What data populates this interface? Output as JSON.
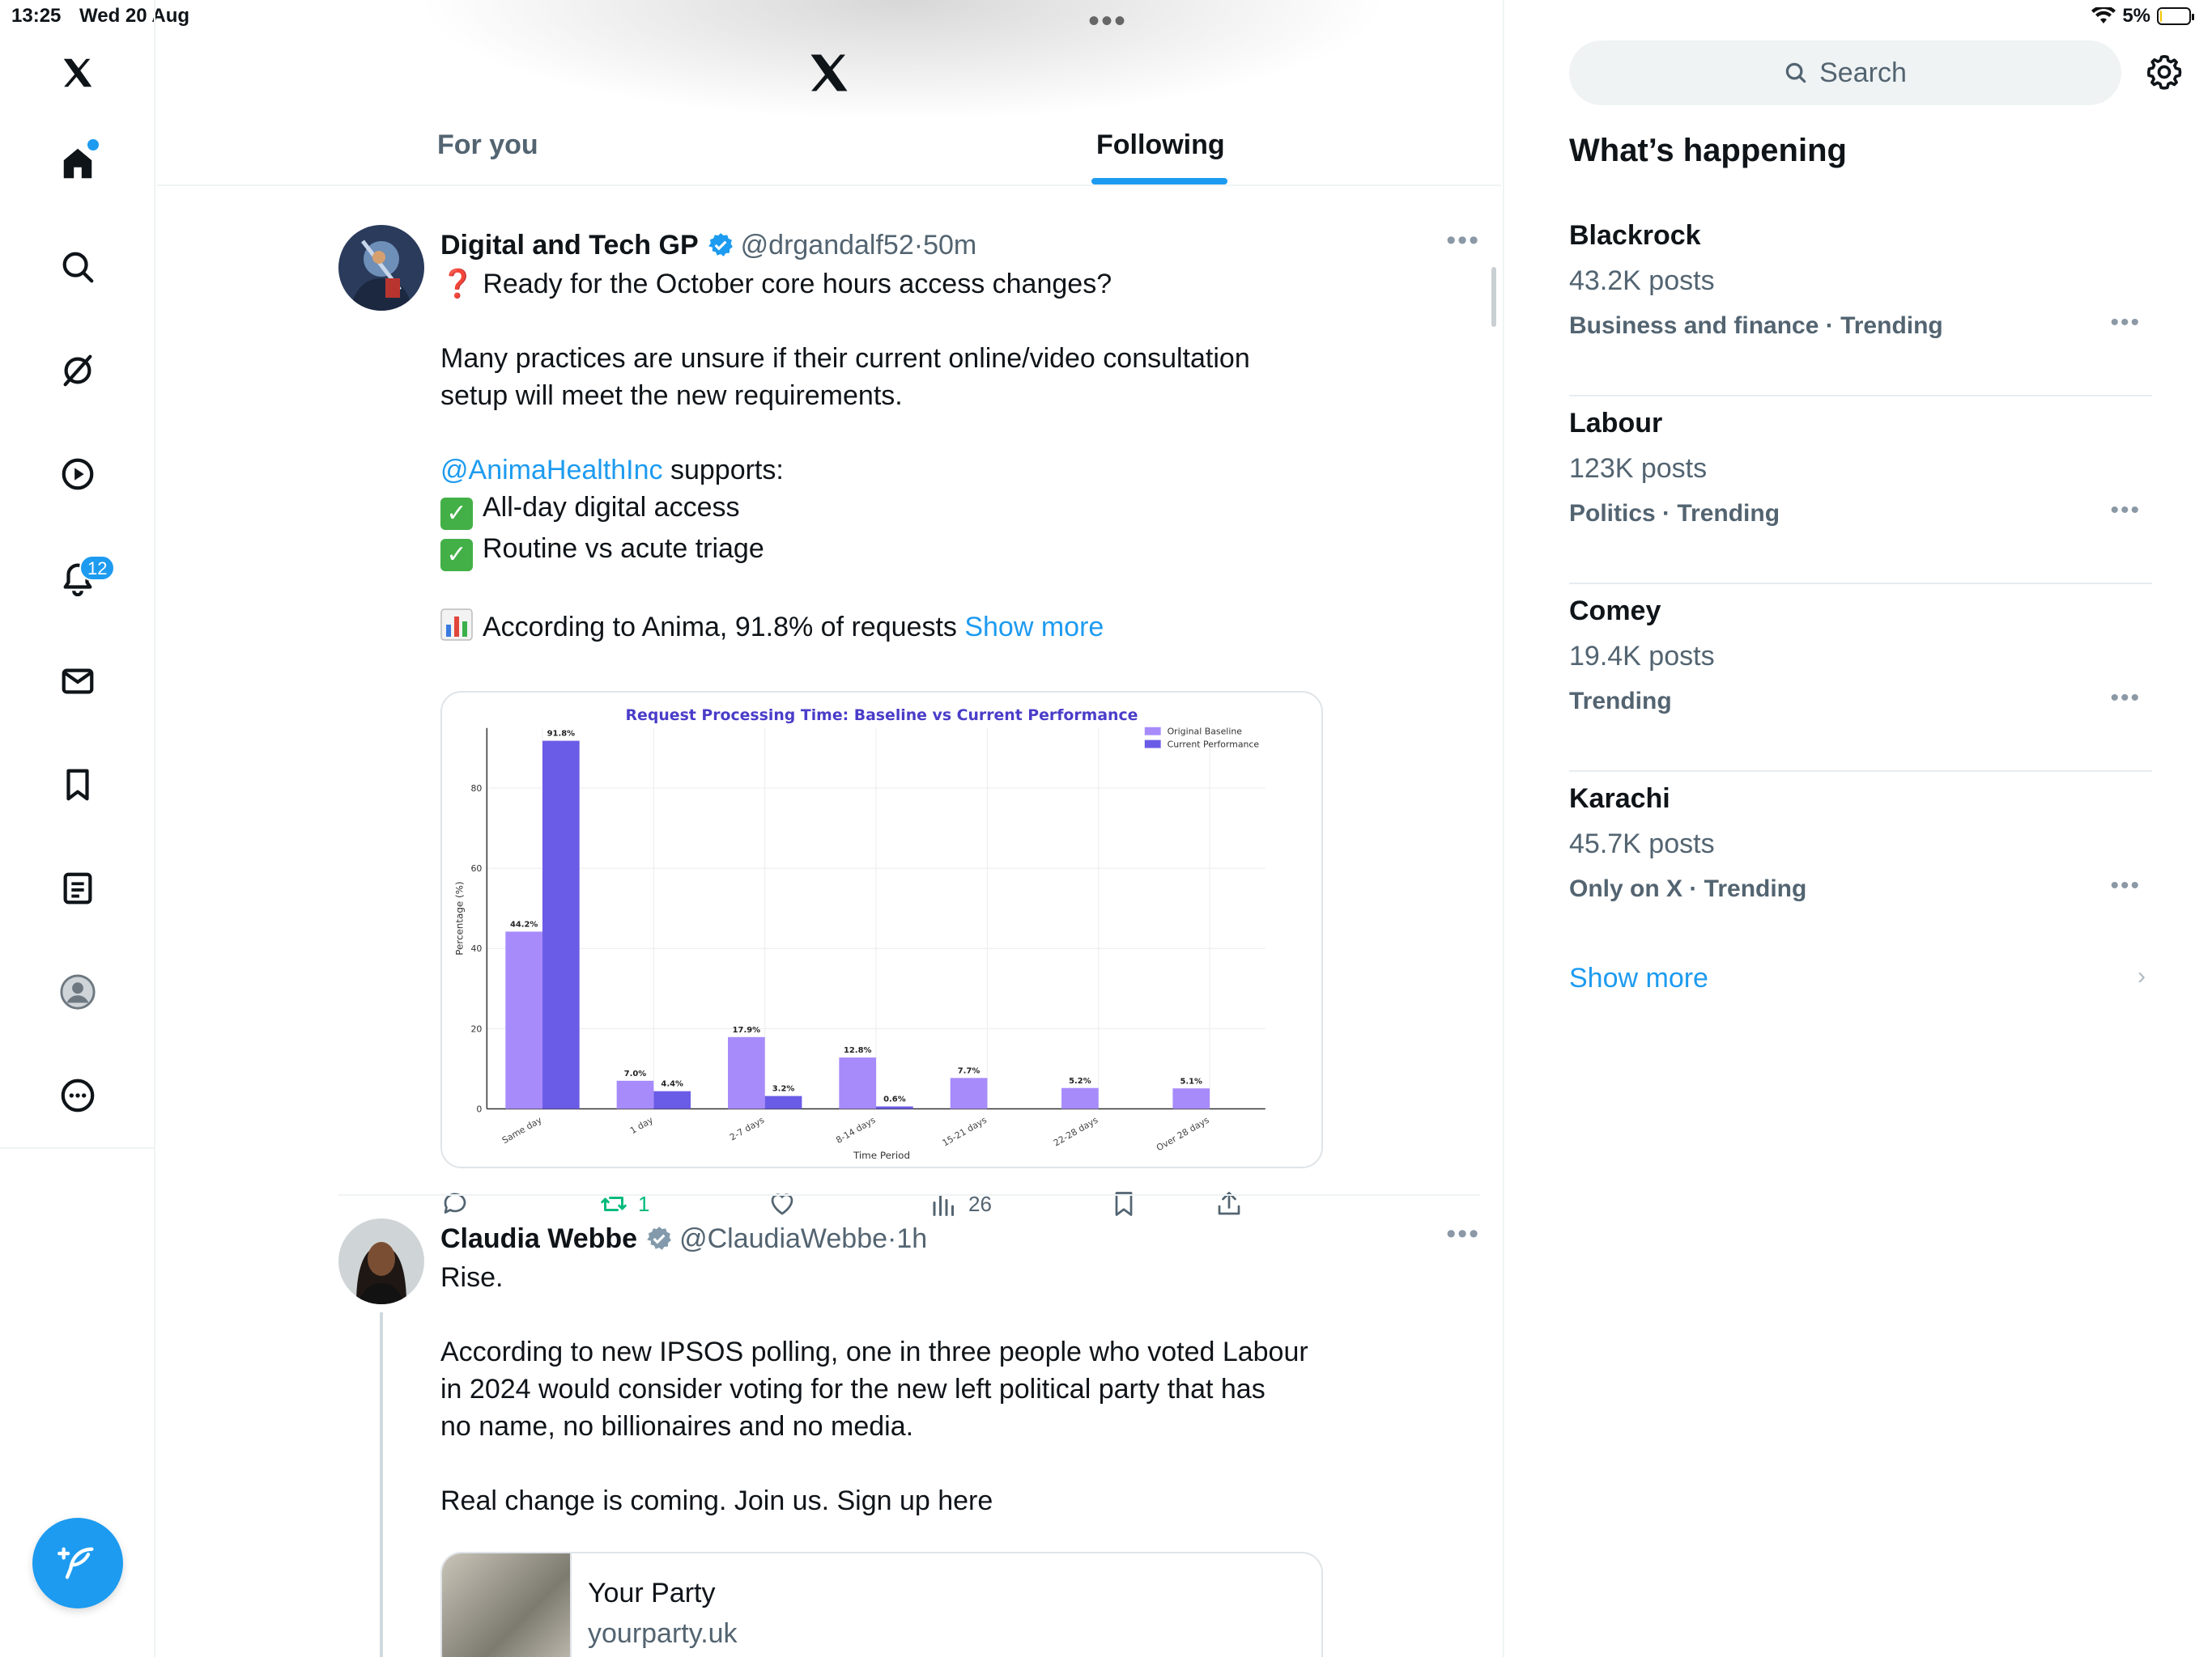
{
  "status_bar": {
    "time": "13:25",
    "date": "Wed 20 Aug",
    "battery": "5%",
    "battery_level": 0.05
  },
  "nav": {
    "items": [
      "home",
      "explore",
      "grok",
      "video",
      "notifications",
      "messages",
      "bookmarks",
      "lists",
      "profile",
      "more"
    ],
    "notifications_badge": "12",
    "compose_icon": "compose-icon"
  },
  "header": {
    "tabs": [
      {
        "label": "For you",
        "selected": false
      },
      {
        "label": "Following",
        "selected": true
      }
    ]
  },
  "posts": [
    {
      "author": "Digital and Tech GP",
      "handle": "@drgandalf52",
      "time": "50m",
      "verified_color": "#1d9bf0",
      "lines": [
        "Ready for the October core hours access changes?",
        "",
        "Many practices are unsure if their current online/video consultation",
        "setup will meet the new requirements.",
        "",
        "@AnimaHealthInc",
        " supports:",
        "All-day digital access",
        "Routine vs acute triage",
        "",
        "According to Anima, 91.8% of requests"
      ],
      "show_more": "Show more",
      "stats": {
        "replies": "",
        "reposts": "1",
        "likes": "",
        "views": "26"
      }
    },
    {
      "author": "Claudia Webbe",
      "handle": "@ClaudiaWebbe",
      "time": "1h",
      "verified_color": "#829aab",
      "lines": [
        "Rise.",
        "",
        "According to new IPSOS polling, one in three people who voted Labour",
        "in 2024 would consider voting for the new left political party that has",
        "no name, no billionaires and no media.",
        "",
        "Real change is coming. Join us. Sign up here"
      ],
      "card": {
        "title": "Your Party",
        "domain": "yourparty.uk"
      }
    }
  ],
  "chart_data": {
    "type": "bar",
    "title": "Request Processing Time: Baseline vs Current Performance",
    "xlabel": "Time Period",
    "ylabel": "Percentage (%)",
    "ylim": [
      0,
      95
    ],
    "yticks": [
      0,
      20,
      40,
      60,
      80
    ],
    "categories": [
      "Same day",
      "1 day",
      "2-7 days",
      "8-14 days",
      "15-21 days",
      "22-28 days",
      "Over 28 days"
    ],
    "series": [
      {
        "name": "Original Baseline",
        "color": "#a78bfa",
        "values": [
          44.2,
          7.0,
          17.9,
          12.8,
          7.7,
          5.2,
          5.1
        ],
        "labels": [
          "44.2%",
          "7.0%",
          "17.9%",
          "12.8%",
          "7.7%",
          "5.2%",
          "5.1%"
        ]
      },
      {
        "name": "Current Performance",
        "color": "#6b5ce7",
        "values": [
          91.8,
          4.4,
          3.2,
          0.6,
          0,
          0,
          0
        ],
        "labels": [
          "91.8%",
          "4.4%",
          "3.2%",
          "0.6%",
          "",
          "",
          ""
        ]
      }
    ],
    "legend_position": "top-right",
    "grid": true
  },
  "sidebar": {
    "search_placeholder": "Search",
    "title": "What’s happening",
    "trends": [
      {
        "name": "Blackrock",
        "count": "43.2K posts",
        "meta": "Business and finance · Trending"
      },
      {
        "name": "Labour",
        "count": "123K posts",
        "meta": "Politics · Trending"
      },
      {
        "name": "Comey",
        "count": "19.4K posts",
        "meta": "Trending"
      },
      {
        "name": "Karachi",
        "count": "45.7K posts",
        "meta": "Only on X · Trending"
      }
    ],
    "show_more": "Show more"
  },
  "colors": {
    "accent": "#1d9bf0",
    "repost": "#00ba7c",
    "text": "#0f1419",
    "muted": "#536471"
  }
}
